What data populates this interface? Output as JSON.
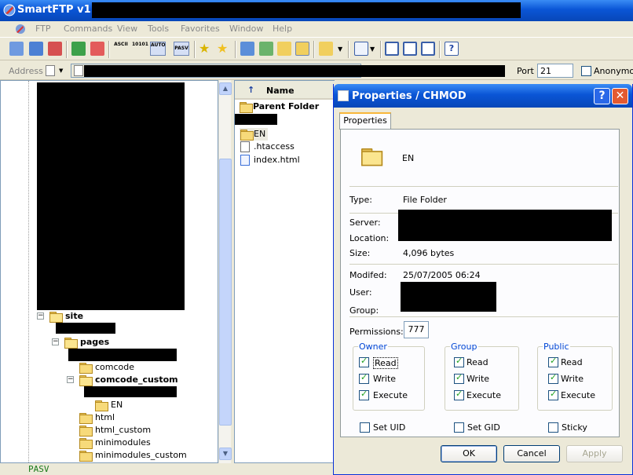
{
  "app": {
    "title": "SmartFTP v1.0"
  },
  "menu": [
    "FTP",
    "Commands",
    "View",
    "Tools",
    "Favorites",
    "Window",
    "Help"
  ],
  "toolbar": {
    "ascii": "ASCII",
    "binary": "10101",
    "auto": "AUTO",
    "pasv": "PASV"
  },
  "address": {
    "label": "Address",
    "port_label": "Port",
    "port_value": "21",
    "anonymous_label": "Anonymous"
  },
  "tree": {
    "items": [
      {
        "label": "site",
        "bold": true
      },
      {
        "label": "pages",
        "bold": true
      },
      {
        "label": "comcode",
        "bold": false
      },
      {
        "label": "comcode_custom",
        "bold": true
      },
      {
        "label": "EN",
        "bold": false
      },
      {
        "label": "html",
        "bold": false
      },
      {
        "label": "html_custom",
        "bold": false
      },
      {
        "label": "minimodules",
        "bold": false
      },
      {
        "label": "minimodules_custom",
        "bold": false
      }
    ]
  },
  "list": {
    "column_name": "Name",
    "items": [
      "Parent Folder",
      "EN",
      ".htaccess",
      "index.html"
    ]
  },
  "status": {
    "text": "PASV"
  },
  "dialog": {
    "title": "Properties / CHMOD",
    "tab": "Properties",
    "name": "EN",
    "type_label": "Type:",
    "type_value": "File Folder",
    "server_label": "Server:",
    "location_label": "Location:",
    "size_label": "Size:",
    "size_value": "4,096 bytes",
    "modified_label": "Modifed:",
    "modified_value": "25/07/2005 06:24",
    "user_label": "User:",
    "group_label": "Group:",
    "permissions_label": "Permissions:",
    "permissions_value": "777",
    "owner": {
      "title": "Owner",
      "read": "Read",
      "write": "Write",
      "execute": "Execute"
    },
    "group": {
      "title": "Group",
      "read": "Read",
      "write": "Write",
      "execute": "Execute"
    },
    "public": {
      "title": "Public",
      "read": "Read",
      "write": "Write",
      "execute": "Execute"
    },
    "set_uid": "Set UID",
    "set_gid": "Set GID",
    "sticky": "Sticky",
    "ok": "OK",
    "cancel": "Cancel",
    "apply": "Apply"
  },
  "colors": {
    "title_bar": "#0a55d6",
    "dialog_border": "#0831d9",
    "checkmark": "#21a121",
    "group_title": "#0046d5"
  }
}
